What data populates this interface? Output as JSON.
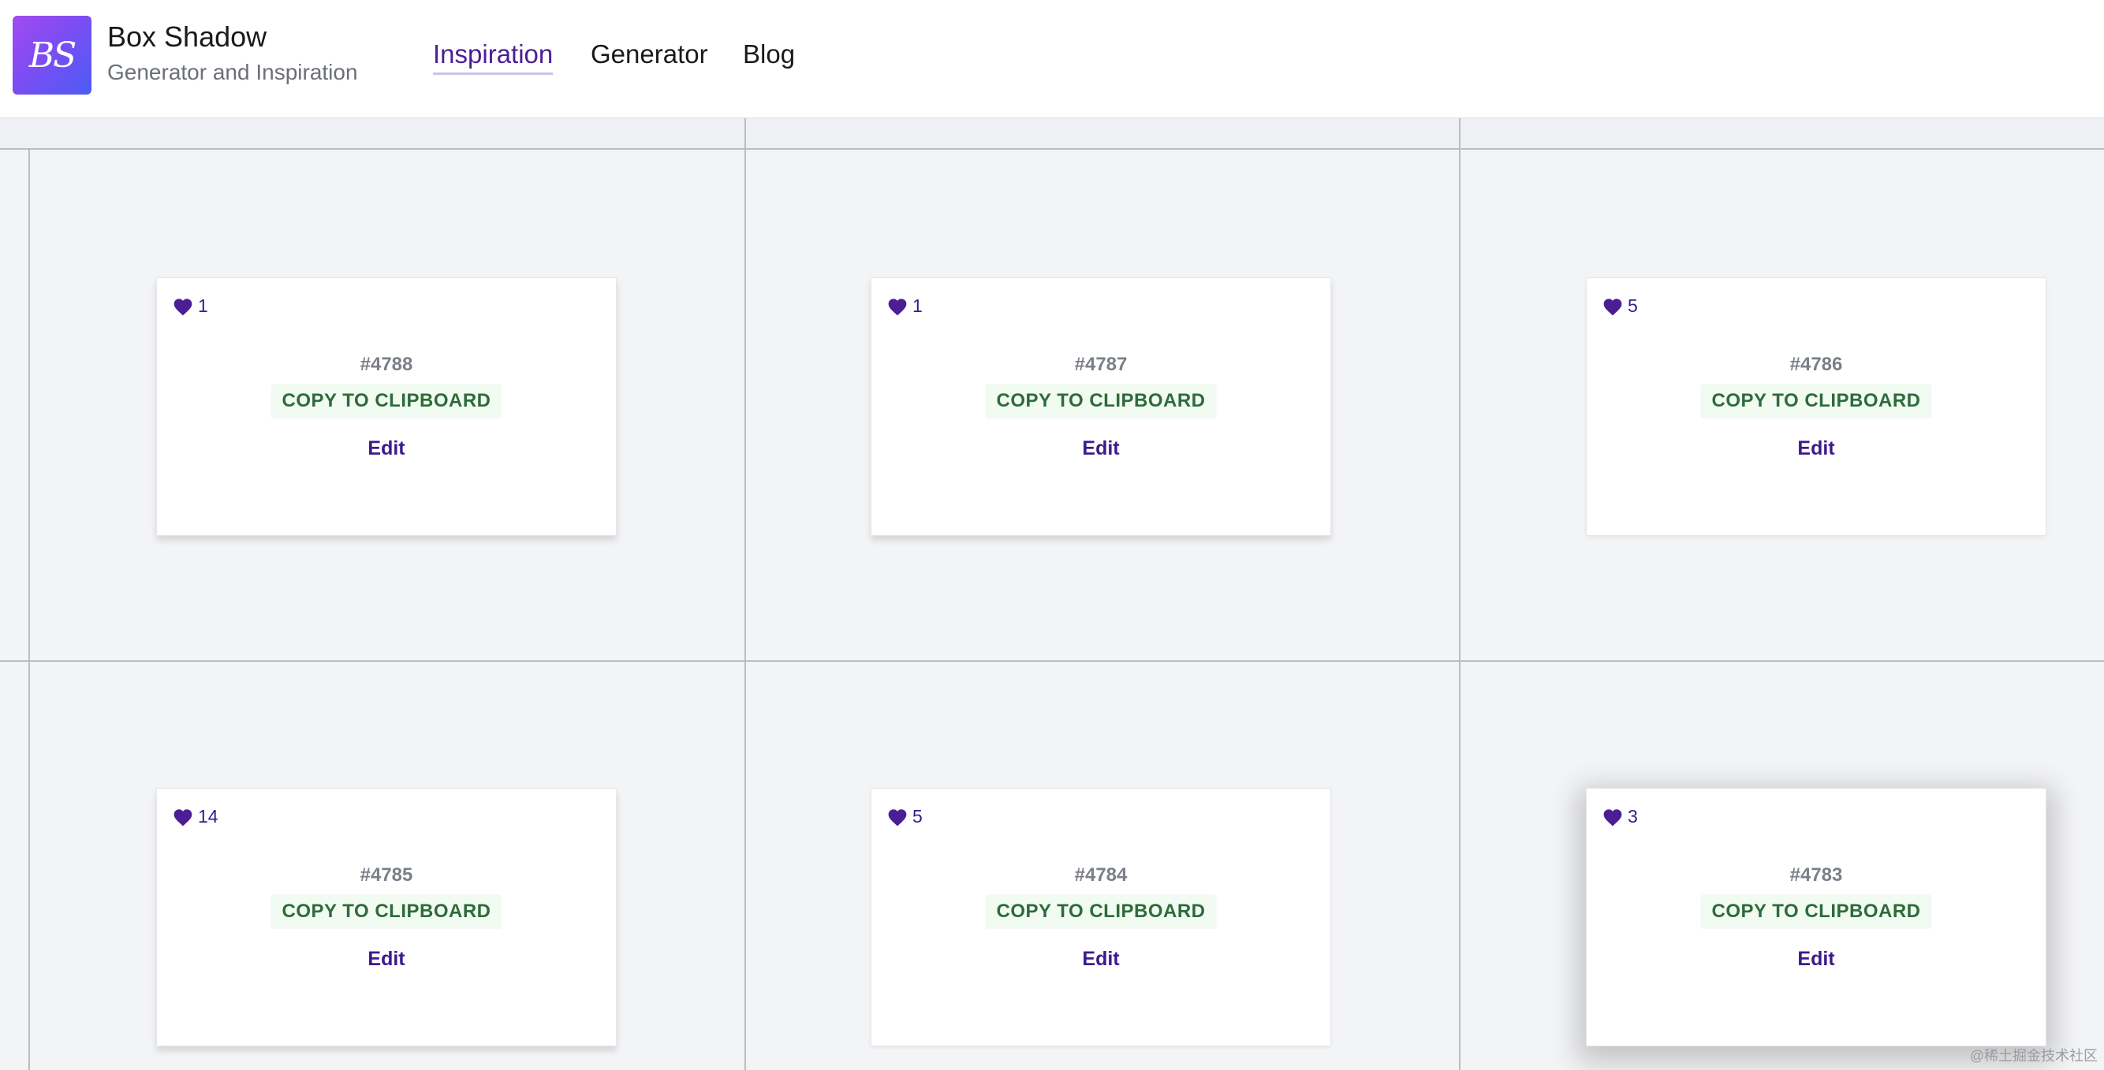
{
  "brand": {
    "logo_text": "BS",
    "title": "Box Shadow",
    "subtitle": "Generator and Inspiration",
    "logo_gradient": [
      "#a24bf0",
      "#4b5cf5"
    ]
  },
  "nav": {
    "items": [
      {
        "label": "Inspiration",
        "active": true
      },
      {
        "label": "Generator",
        "active": false
      },
      {
        "label": "Blog",
        "active": false
      }
    ]
  },
  "colors": {
    "accent": "#4c1d95",
    "copy_text": "#2e6b3a",
    "copy_bg": "#f1fbf1"
  },
  "cards": [
    {
      "likes": "1",
      "id": "#4788",
      "copy_label": "COPY TO CLIPBOARD",
      "edit_label": "Edit"
    },
    {
      "likes": "1",
      "id": "#4787",
      "copy_label": "COPY TO CLIPBOARD",
      "edit_label": "Edit"
    },
    {
      "likes": "5",
      "id": "#4786",
      "copy_label": "COPY TO CLIPBOARD",
      "edit_label": "Edit"
    },
    {
      "likes": "14",
      "id": "#4785",
      "copy_label": "COPY TO CLIPBOARD",
      "edit_label": "Edit"
    },
    {
      "likes": "5",
      "id": "#4784",
      "copy_label": "COPY TO CLIPBOARD",
      "edit_label": "Edit"
    },
    {
      "likes": "3",
      "id": "#4783",
      "copy_label": "COPY TO CLIPBOARD",
      "edit_label": "Edit"
    }
  ],
  "watermark": "@稀土掘金技术社区"
}
